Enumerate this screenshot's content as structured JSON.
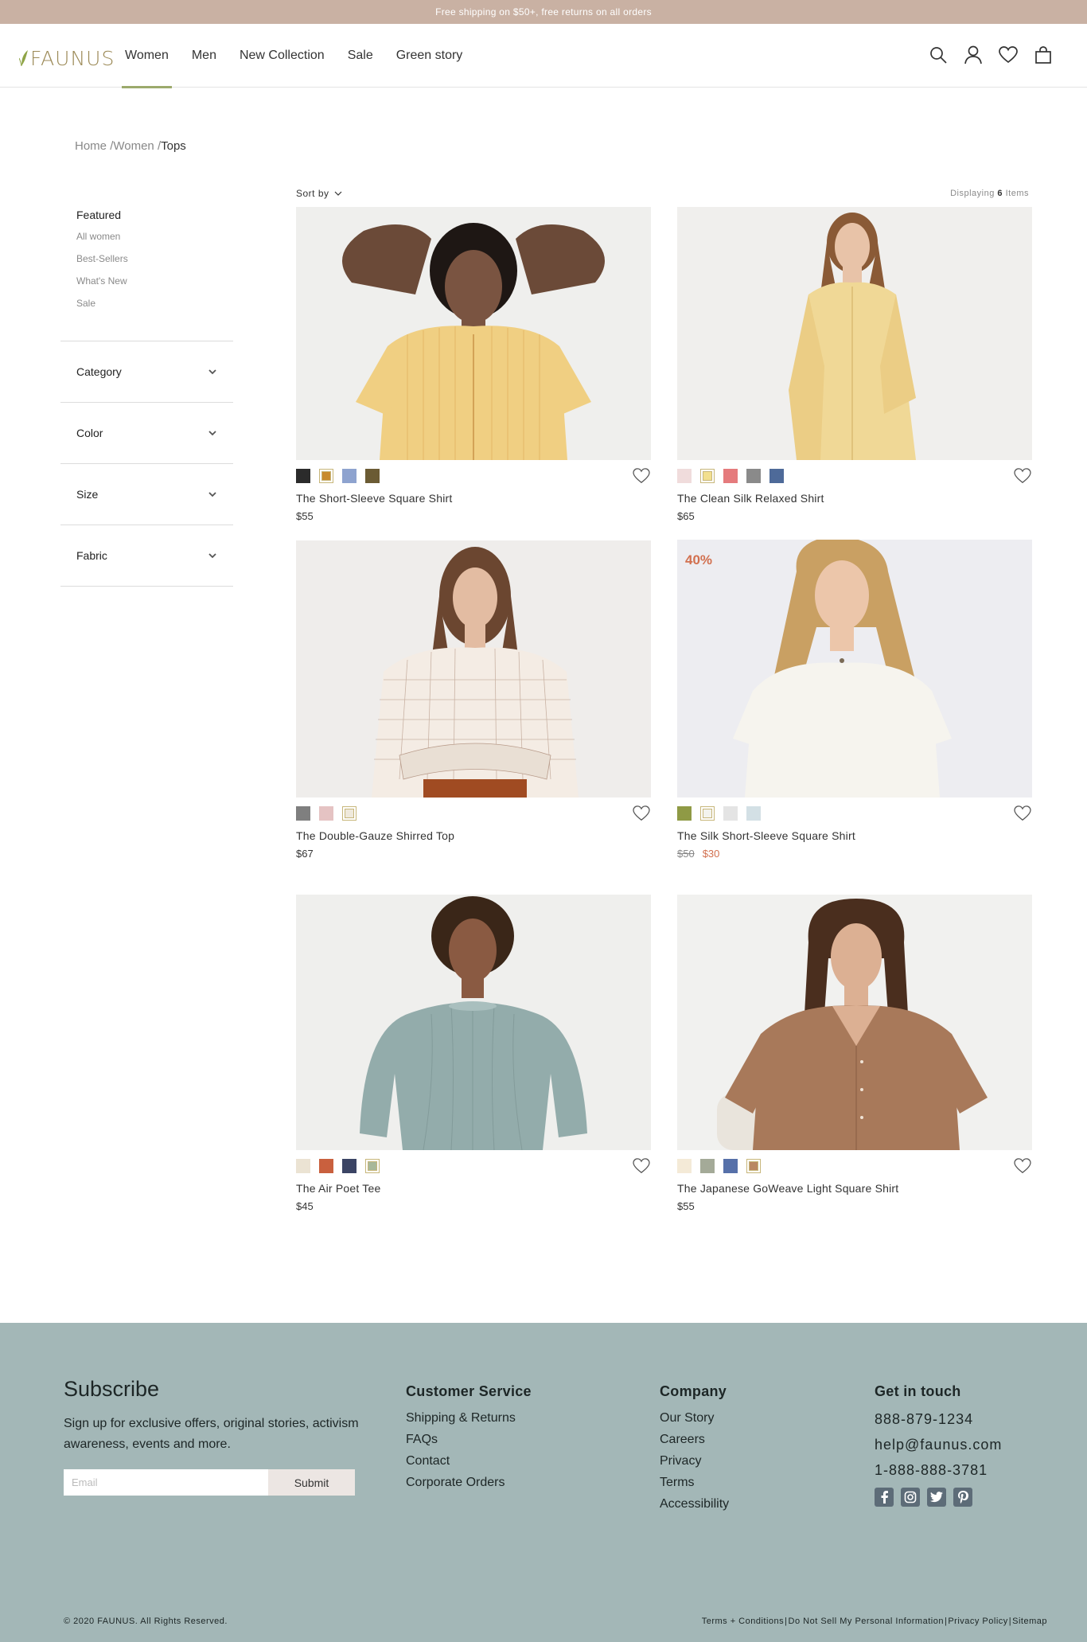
{
  "announcement": "Free shipping on $50+, free returns on all orders",
  "brand": {
    "name": "FAUNUS",
    "accent": "#9c8a57",
    "leaf_color": "#8fa447"
  },
  "nav": [
    {
      "label": "Women",
      "active": true
    },
    {
      "label": "Men",
      "active": false
    },
    {
      "label": "New Collection",
      "active": false
    },
    {
      "label": "Sale",
      "active": false
    },
    {
      "label": "Green story",
      "active": false
    }
  ],
  "header_icons": [
    "search-icon",
    "user-icon",
    "heart-icon",
    "shopping-bag-icon"
  ],
  "breadcrumb": {
    "home": "Home",
    "sep1": "/",
    "women": "Women",
    "sep2": "/",
    "current": "Tops"
  },
  "sidebar": {
    "featured_heading": "Featured",
    "featured_links": [
      "All women",
      "Best-Sellers",
      "What's New",
      "Sale"
    ],
    "filters": [
      "Category",
      "Color",
      "Size",
      "Fabric"
    ]
  },
  "toolbar": {
    "sort_label": "Sort by",
    "displaying_prefix": "Displaying",
    "count": "6",
    "items_suffix": "Items"
  },
  "products": [
    {
      "name": "The Short-Sleeve Square Shirt",
      "price": "$55",
      "old_price": "",
      "sale_price": "",
      "badge": "",
      "swatches": [
        "#2b2b2b",
        "#c88a2e",
        "#8ea3cf",
        "#6b5b34"
      ],
      "selected_swatch": 1
    },
    {
      "name": "The Clean Silk Relaxed Shirt",
      "price": "$65",
      "old_price": "",
      "sale_price": "",
      "badge": "",
      "swatches": [
        "#f0dcdc",
        "#f2df8e",
        "#e57b7d",
        "#8a8a8a",
        "#4e6a99"
      ],
      "selected_swatch": 1
    },
    {
      "name": "The Double-Gauze Shirred Top",
      "price": "$67",
      "old_price": "",
      "sale_price": "",
      "badge": "",
      "swatches": [
        "#7f7f7f",
        "#e5c3c3",
        "#efe9dc"
      ],
      "selected_swatch": 2
    },
    {
      "name": "The Silk Short-Sleeve Square Shirt",
      "price": "",
      "old_price": "$50",
      "sale_price": "$30",
      "badge": "40%",
      "swatches": [
        "#8f9a45",
        "#f3f3ee",
        "#e4e4e4",
        "#d3e0e5"
      ],
      "selected_swatch": 1
    },
    {
      "name": "The Air Poet Tee",
      "price": "$45",
      "old_price": "",
      "sale_price": "",
      "badge": "",
      "swatches": [
        "#ebe3d3",
        "#c9603e",
        "#3b4464",
        "#a8b89a"
      ],
      "selected_swatch": 3
    },
    {
      "name": "The Japanese GoWeave Light Square Shirt",
      "price": "$55",
      "old_price": "",
      "sale_price": "",
      "badge": "",
      "swatches": [
        "#f4ead7",
        "#a4aa98",
        "#5670a9",
        "#b98663"
      ],
      "selected_swatch": 3
    }
  ],
  "footer": {
    "subscribe_title": "Subscribe",
    "subscribe_text": "Sign up for exclusive offers, original stories, activism awareness, events and more.",
    "email_placeholder": "Email",
    "submit_label": "Submit",
    "customer_service": {
      "title": "Customer Service",
      "links": [
        "Shipping & Returns",
        "FAQs",
        "Contact",
        "Corporate Orders"
      ]
    },
    "company": {
      "title": "Company",
      "links": [
        "Our Story",
        "Careers",
        "Privacy",
        "Terms",
        "Accessibility"
      ]
    },
    "contact": {
      "title": "Get in touch",
      "lines": [
        "888-879-1234",
        "help@faunus.com",
        "1-888-888-3781"
      ]
    },
    "socials": [
      "facebook-icon",
      "instagram-icon",
      "twitter-icon",
      "pinterest-icon"
    ],
    "copyright": "© 2020 FAUNUS. All Rights Reserved.",
    "legal": [
      "Terms + Conditions",
      "Do Not Sell My Personal Information",
      "Privacy Policy",
      "Sitemap"
    ],
    "legal_sep": "|"
  }
}
